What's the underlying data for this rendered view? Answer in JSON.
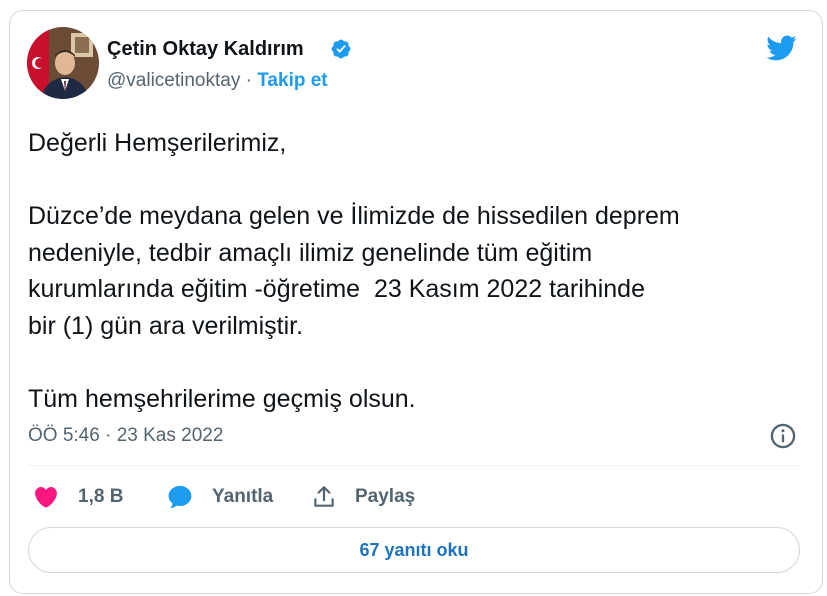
{
  "colors": {
    "accent": "#1d9bf0",
    "like": "#f91880",
    "muted": "#536471",
    "text": "#0f1419"
  },
  "author": {
    "name": "Çetin Oktay Kaldırım",
    "handle": "@valicetinoktay",
    "separator": " · ",
    "follow_label": "Takip et",
    "verified_icon": "verified-badge-icon"
  },
  "tweet": {
    "text": "Değerli Hemşerilerimiz,\n\nDüzce’de meydana gelen ve İlimizde de hissedilen deprem\nnedeniyle, tedbir amaçlı ilimiz genelinde tüm eğitim\nkurumlarında eğitim -öğretime  23 Kasım 2022 tarihinde\nbir (1) gün ara verilmiştir.\n\nTüm hemşehrilerime geçmiş olsun.",
    "timestamp": "ÖÖ 5:46 · 23 Kas 2022"
  },
  "actions": {
    "likes_count": "1,8 B",
    "reply_label": "Yanıtla",
    "share_label": "Paylaş"
  },
  "replies_button": "67 yanıtı oku"
}
